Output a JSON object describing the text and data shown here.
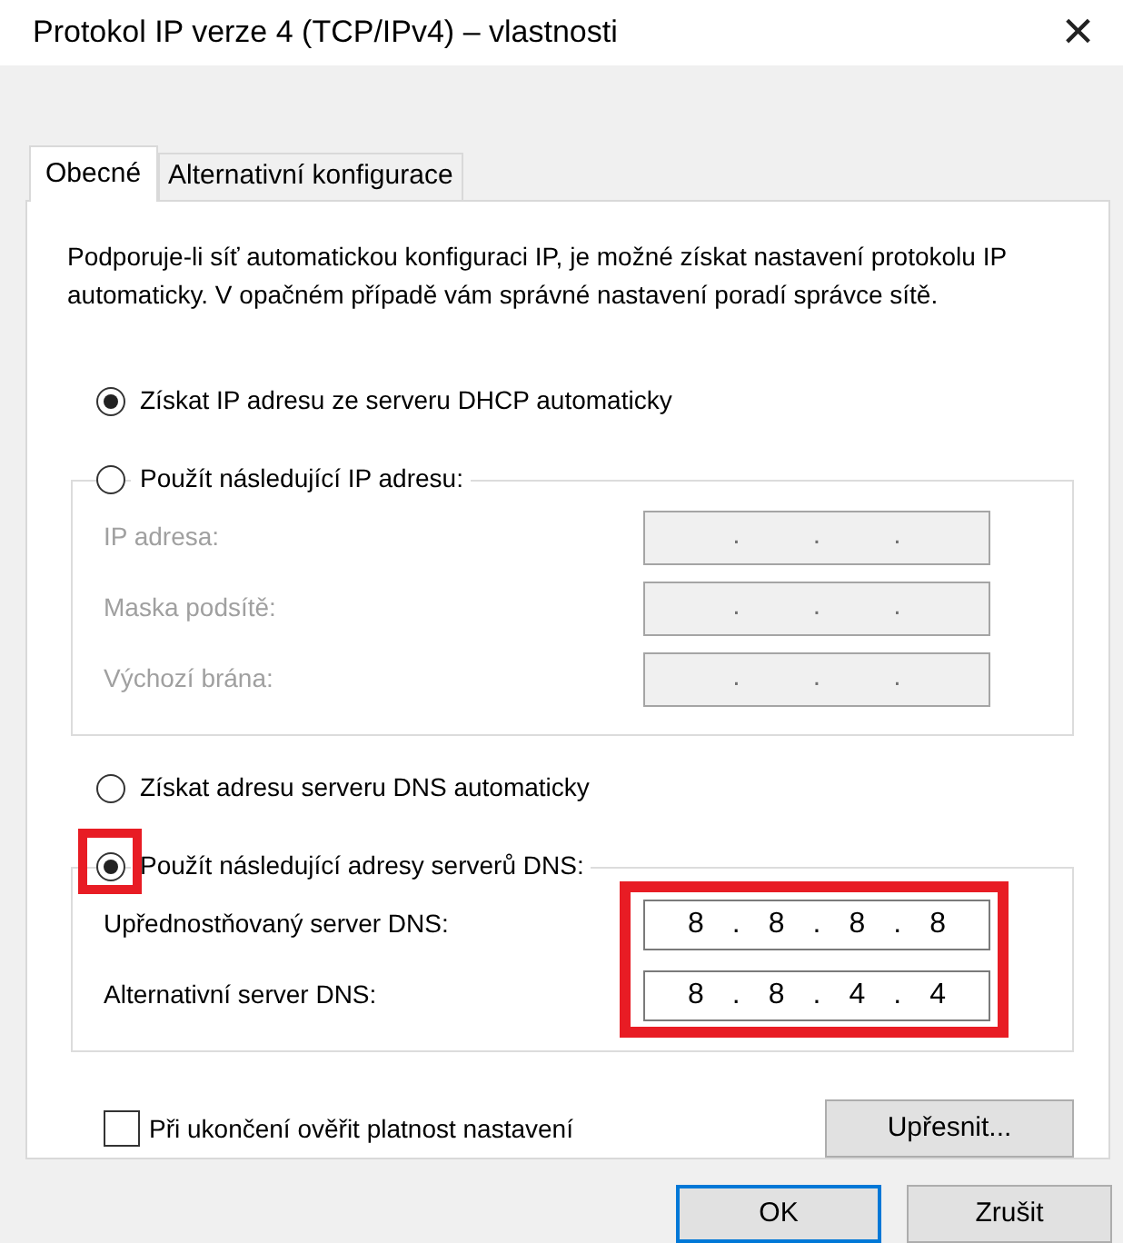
{
  "window": {
    "title": "Protokol IP verze 4 (TCP/IPv4) – vlastnosti",
    "close": "×"
  },
  "tabs": [
    {
      "label": "Obecné",
      "selected": true
    },
    {
      "label": "Alternativní konfigurace",
      "selected": false
    }
  ],
  "description": "Podporuje-li síť automatickou konfiguraci IP, je možné získat nastavení protokolu IP automaticky. V opačném případě vám správné nastavení poradí správce sítě.",
  "ip": {
    "auto_option": {
      "label": "Získat IP adresu ze serveru DHCP automaticky",
      "selected": true
    },
    "manual_option": {
      "label": "Použít následující IP adresu:",
      "selected": false
    },
    "fields": [
      {
        "label": "IP adresa:",
        "disabled": true,
        "segments": [
          ".",
          ".",
          "."
        ]
      },
      {
        "label": "Maska podsítě:",
        "disabled": true,
        "segments": [
          ".",
          ".",
          "."
        ]
      },
      {
        "label": "Výchozí brána:",
        "disabled": true,
        "segments": [
          ".",
          ".",
          "."
        ]
      }
    ]
  },
  "dns": {
    "auto_option": {
      "label": "Získat adresu serveru DNS automaticky",
      "selected": false
    },
    "manual_option": {
      "label": "Použít následující adresy serverů DNS:",
      "selected": true,
      "highlighted": true
    },
    "fields_highlighted": true,
    "fields": [
      {
        "label": "Upřednostňovaný server DNS:",
        "disabled": false,
        "segments": [
          "8",
          ".",
          "8",
          ".",
          "8",
          ".",
          "8"
        ]
      },
      {
        "label": "Alternativní server DNS:",
        "disabled": false,
        "segments": [
          "8",
          ".",
          "8",
          ".",
          "4",
          ".",
          "4"
        ]
      }
    ]
  },
  "validate": {
    "label": "Při ukončení ověřit platnost nastavení",
    "checked": false
  },
  "advanced_button": "Upřesnit...",
  "buttons": [
    {
      "label": "OK",
      "default": true
    },
    {
      "label": "Zrušit",
      "default": false
    }
  ]
}
